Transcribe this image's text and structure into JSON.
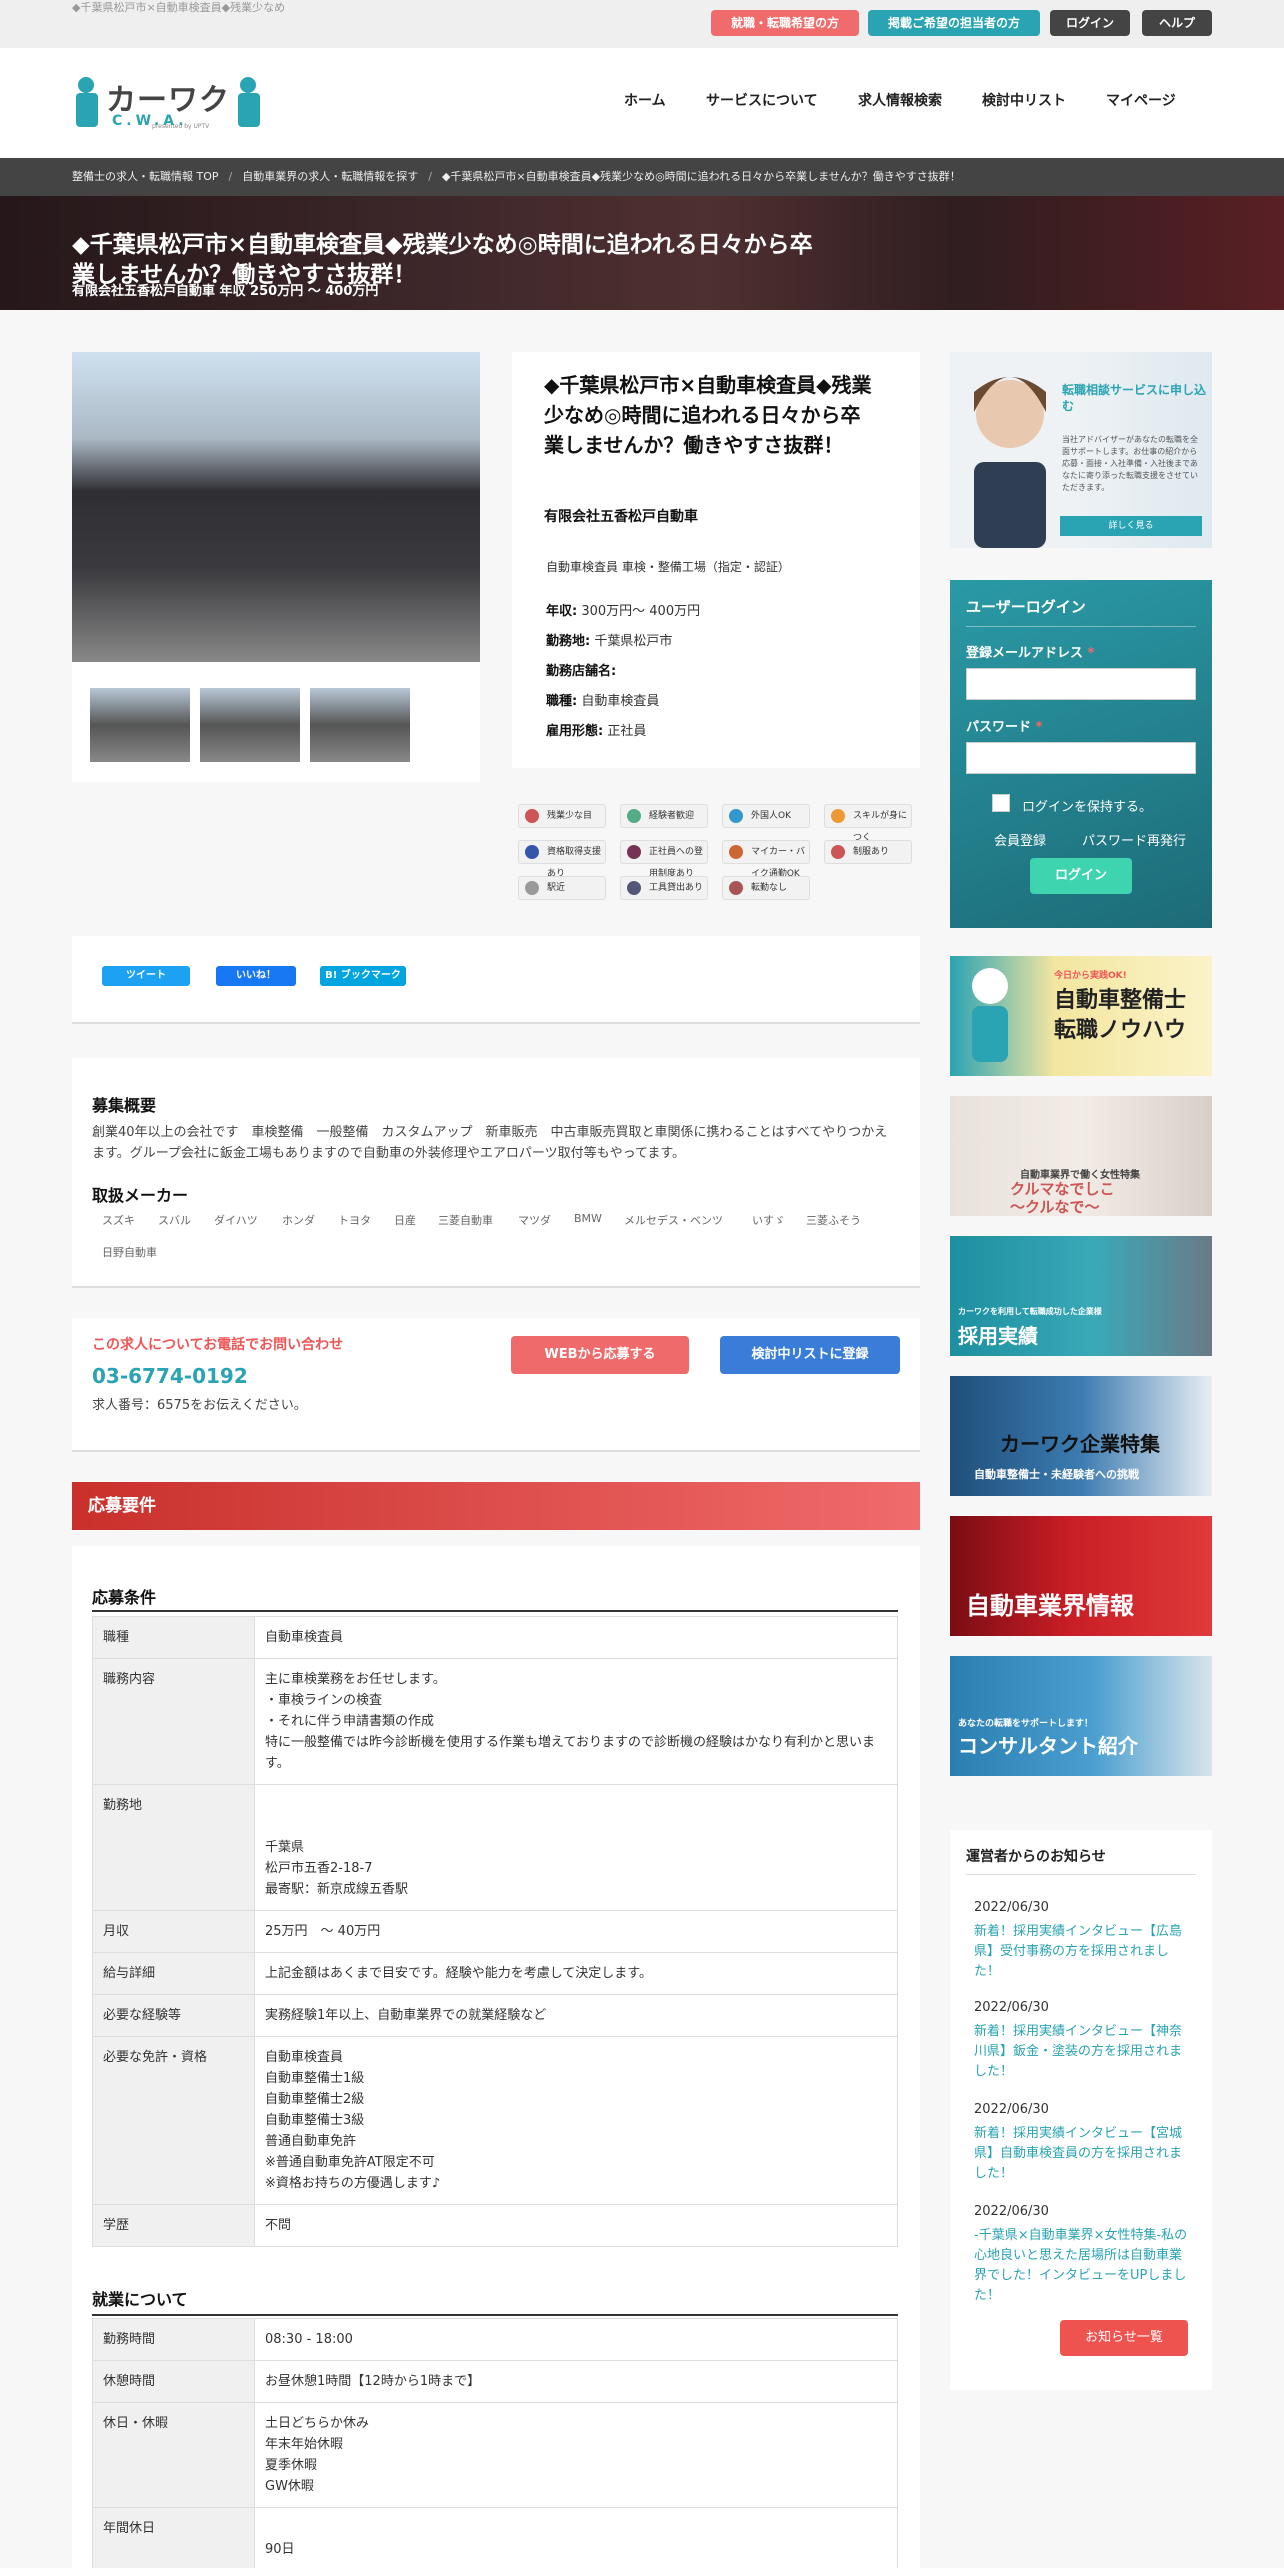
{
  "topbar": {
    "tagline": "◆千葉県松戸市×自動車検査員◆残業少なめ",
    "btn_seeker": "就職・転職希望の方",
    "btn_employer": "掲載ご希望の担当者の方",
    "btn_login": "ログイン",
    "btn_help": "ヘルプ",
    "colors": {
      "seeker": "#f06b6b",
      "employer": "#2aa3b3",
      "dark": "#444444"
    }
  },
  "logo": {
    "main": "カーワク",
    "sub": "C.W.A.",
    "presented": "presented by UPTV"
  },
  "nav": [
    "ホーム",
    "サービスについて",
    "求人情報検索",
    "検討中リスト",
    "マイページ"
  ],
  "breadcrumb": [
    "整備士の求人・転職情報 TOP",
    "自動車業界の求人・転職情報を探す",
    "◆千葉県松戸市×自動車検査員◆残業少なめ◎時間に追われる日々から卒業しませんか？働きやすさ抜群！"
  ],
  "hero": {
    "title": "◆千葉県松戸市×自動車検査員◆残業少なめ◎時間に追われる日々から卒業しませんか？働きやすさ抜群！",
    "sub": "有限会社五香松戸自動車 年収 250万円 〜 400万円"
  },
  "job": {
    "title": "◆千葉県松戸市×自動車検査員◆残業少なめ◎時間に追われる日々から卒業しませんか？働きやすさ抜群！",
    "company": "有限会社五香松戸自動車",
    "category": "自動車検査員 車検・整備工場（指定・認証）",
    "salary_label": "年収:",
    "salary": "300万円〜 400万円",
    "location_label": "勤務地:",
    "location": "千葉県松戸市",
    "store_label": "勤務店舗名:",
    "occupation_label": "職種:",
    "occupation": "自動車検査員",
    "employment_label": "雇用形態:",
    "employment": "正社員"
  },
  "tags": [
    "残業少な目",
    "経験者歓迎",
    "外国人OK",
    "スキルが身につく",
    "資格取得支援あり",
    "正社員への登用制度あり",
    "マイカー・バイク通勤OK",
    "制服あり",
    "駅近",
    "工具貸出あり",
    "転勤なし"
  ],
  "share": {
    "tweet": "ツイート",
    "like": "いいね！",
    "hatena": "B! ブックマーク"
  },
  "summary": {
    "title": "募集概要",
    "text": "創業40年以上の会社です　車検整備　一般整備　カスタムアップ　新車販売　中古車販売買取と車関係に携わることはすべてやりつかえます。グループ会社に鈑金工場もありますので自動車の外装修理やエアロパーツ取付等もやってます。",
    "makers_title": "取扱メーカー",
    "makers": [
      "スズキ",
      "スバル",
      "ダイハツ",
      "ホンダ",
      "トヨタ",
      "日産",
      "三菱自動車",
      "マツダ",
      "BMW",
      "メルセデス・ベンツ",
      "いすゞ",
      "三菱ふそう",
      "日野自動車"
    ]
  },
  "contact": {
    "title": "この求人についてお電話でお問い合わせ",
    "phone": "03-6774-0192",
    "note": "求人番号：6575をお伝えください。",
    "apply": "WEBから応募する",
    "consider": "検討中リストに登録"
  },
  "req": {
    "bar": "応募要件",
    "title": "応募条件",
    "rows": [
      {
        "k": "職種",
        "v": "自動車検査員"
      },
      {
        "k": "職務内容",
        "v": "主に車検業務をお任せします。\n・車検ラインの検査\n・それに伴う申請書類の作成\n特に一般整備では昨今診断機を使用する作業も増えておりますので診断機の経験はかなり有利かと思います。"
      },
      {
        "k": "勤務地",
        "v": "\n\n千葉県\n松戸市五香2-18-7\n最寄駅：新京成線五香駅\n"
      },
      {
        "k": "月収",
        "v": "25万円　〜 40万円"
      },
      {
        "k": "給与詳細",
        "v": "上記金額はあくまで目安です。経験や能力を考慮して決定します。"
      },
      {
        "k": "必要な経験等",
        "v": "実務経験1年以上、自動車業界での就業経験など"
      },
      {
        "k": "必要な免許・資格",
        "v": "自動車検査員\n自動車整備士1級\n自動車整備士2級\n自動車整備士3級\n普通自動車免許\n※普通自動車免許AT限定不可\n※資格お持ちの方優遇します♪"
      },
      {
        "k": "学歴",
        "v": "不問"
      }
    ]
  },
  "work": {
    "title": "就業について",
    "rows": [
      {
        "k": "勤務時間",
        "v": "08:30 - 18:00"
      },
      {
        "k": "休憩時間",
        "v": "お昼休憩1時間【12時から1時まで】"
      },
      {
        "k": "休日・休暇",
        "v": "土日どちらか休み\n年末年始休暇\n夏季休暇\nGW休暇\n"
      },
      {
        "k": "年間休日",
        "v": "\n90日"
      }
    ]
  },
  "side": {
    "consult": {
      "title": "転職相談サービスに申し込む",
      "text": "当社アドバイザーがあなたの転職を全面サポートします。お仕事の紹介から応募・面接・入社準備・入社後まであなたに寄り添った転職支援をさせていただきます。",
      "btn": "詳しく見る"
    },
    "login": {
      "title": "ユーザーログイン",
      "email": "登録メールアドレス",
      "password": "パスワード",
      "required": "*",
      "remember": "ログインを保持する。",
      "register": "会員登録",
      "reset": "パスワード再発行",
      "submit": "ログイン"
    },
    "banners": [
      {
        "small": "今日から実践OK!",
        "big": "自動車整備士\n転職ノウハウ"
      },
      {
        "small": "自動車業界で働く女性特集",
        "big": "クルマなでしこ\n〜クルなで〜"
      },
      {
        "small": "カーワクを利用して転職成功した企業様",
        "big": "採用実績"
      },
      {
        "small": "自動車整備士・未経験者への挑戦",
        "big": "カーワク企業特集"
      },
      {
        "small": "",
        "big": "自動車業界情報"
      },
      {
        "small": "あなたの転職をサポートします！",
        "big": "コンサルタント紹介"
      }
    ],
    "news": {
      "title": "運営者からのお知らせ",
      "items": [
        {
          "date": "2022/06/30",
          "text": "新着！採用実績インタビュー【広島県】受付事務の方を採用されました！"
        },
        {
          "date": "2022/06/30",
          "text": "新着！採用実績インタビュー【神奈川県】鈑金・塗装の方を採用されました！"
        },
        {
          "date": "2022/06/30",
          "text": "新着！採用実績インタビュー【宮城県】自動車検査員の方を採用されました！"
        },
        {
          "date": "2022/06/30",
          "text": "-千葉県×自動車業界×女性特集-私の心地良いと思えた居場所は自動車業界でした！インタビューをUPしました！"
        }
      ],
      "more": "お知らせ一覧"
    }
  }
}
